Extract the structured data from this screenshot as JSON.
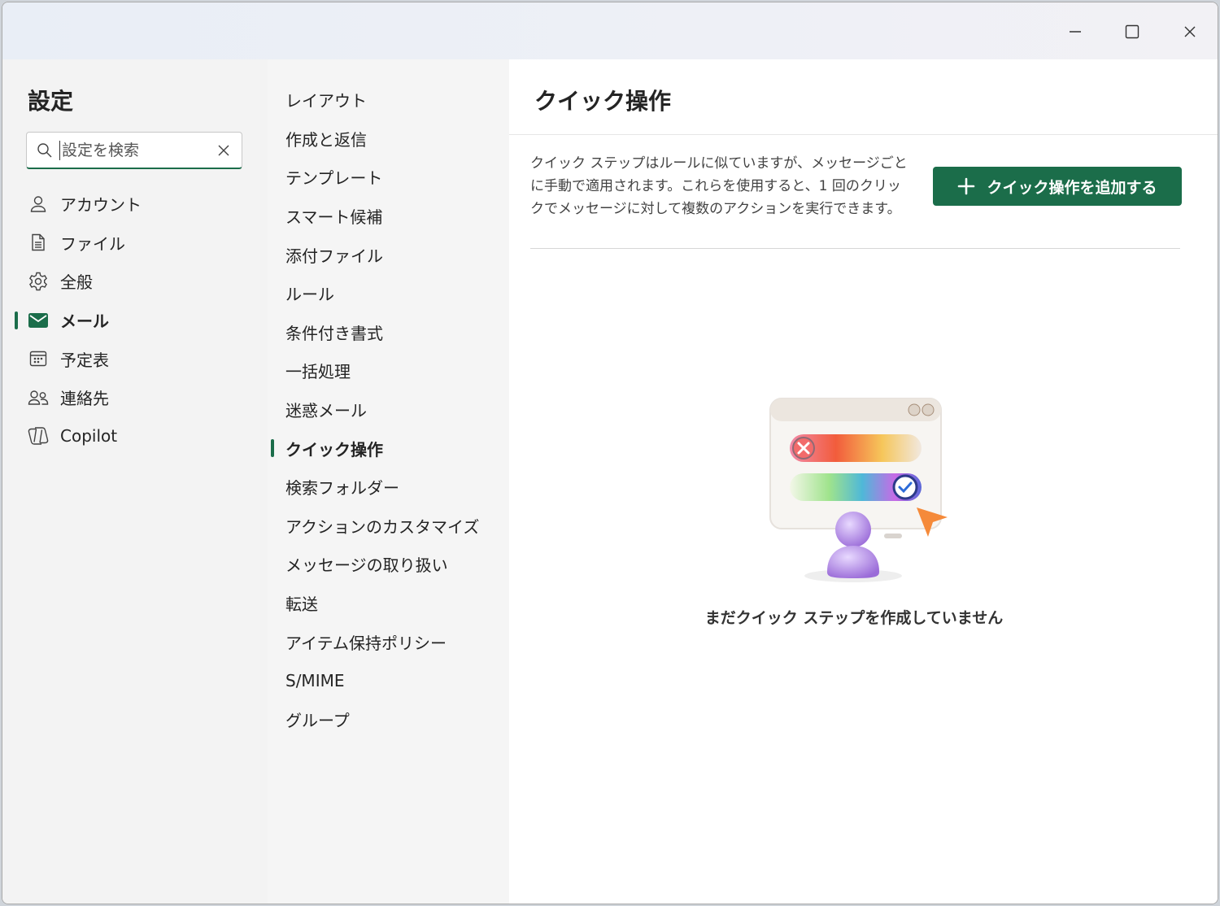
{
  "window": {
    "controls": [
      "minimize",
      "maximize",
      "close"
    ]
  },
  "settings": {
    "title": "設定",
    "search": {
      "placeholder": "設定を検索",
      "value": ""
    },
    "categories": [
      {
        "label": "アカウント",
        "icon": "person-icon",
        "active": false
      },
      {
        "label": "ファイル",
        "icon": "document-icon",
        "active": false
      },
      {
        "label": "全般",
        "icon": "gear-icon",
        "active": false
      },
      {
        "label": "メール",
        "icon": "mail-icon",
        "active": true
      },
      {
        "label": "予定表",
        "icon": "calendar-icon",
        "active": false
      },
      {
        "label": "連絡先",
        "icon": "people-icon",
        "active": false
      },
      {
        "label": "Copilot",
        "icon": "copilot-icon",
        "active": false
      }
    ]
  },
  "mail_settings": {
    "items": [
      {
        "label": "レイアウト",
        "active": false
      },
      {
        "label": "作成と返信",
        "active": false
      },
      {
        "label": "テンプレート",
        "active": false
      },
      {
        "label": "スマート候補",
        "active": false
      },
      {
        "label": "添付ファイル",
        "active": false
      },
      {
        "label": "ルール",
        "active": false
      },
      {
        "label": "条件付き書式",
        "active": false
      },
      {
        "label": "一括処理",
        "active": false
      },
      {
        "label": "迷惑メール",
        "active": false
      },
      {
        "label": "クイック操作",
        "active": true
      },
      {
        "label": "検索フォルダー",
        "active": false
      },
      {
        "label": "アクションのカスタマイズ",
        "active": false
      },
      {
        "label": "メッセージの取り扱い",
        "active": false
      },
      {
        "label": "転送",
        "active": false
      },
      {
        "label": "アイテム保持ポリシー",
        "active": false
      },
      {
        "label": "S/MIME",
        "active": false
      },
      {
        "label": "グループ",
        "active": false
      }
    ]
  },
  "quick_steps": {
    "title": "クイック操作",
    "description": "クイック ステップはルールに似ていますが、メッセージごとに手動で適用されます。これらを使用すると、1 回のクリックでメッセージに対して複数のアクションを実行できます。",
    "add_button_label": "クイック操作を追加する",
    "empty_message": "まだクイック ステップを作成していません"
  },
  "colors": {
    "accent": "#1b6d4a",
    "window_bg": "#f3f3f3",
    "content_bg": "#ffffff"
  }
}
